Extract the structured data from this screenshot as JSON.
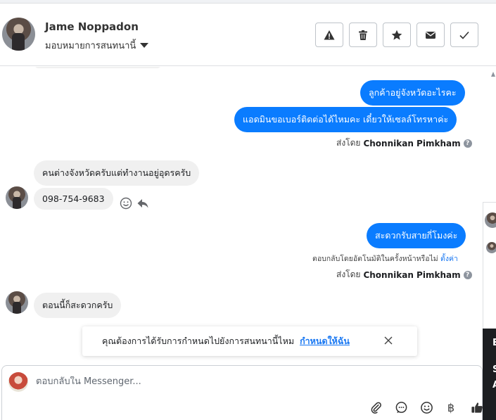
{
  "header": {
    "name": "Jame Noppadon",
    "assign_label": "มอบหมายการสนทนานี้",
    "buttons": {
      "spam": "spam-icon",
      "delete": "trash-icon",
      "star": "star-icon",
      "mark_unread": "envelope-icon",
      "done": "check-icon"
    }
  },
  "messages": {
    "out1": "ลูกค้าอยู่จังหวัดอะไรคะ",
    "out2": "แอดมินขอเบอร์ติดต่อได้ไหมคะ เดี๋ยวให้เซลล์โทรหาค่ะ",
    "sent_by_1_prefix": "ส่งโดย",
    "sent_by_1_name": "Chonnikan Pimkham",
    "in1": "คนต่างจังหวัดครับแต่ทำงานอยู่อุดรครับ",
    "in2": "098-754-9683",
    "out3": "สะดวกรับสายกี่โมงค่ะ",
    "auto_note_text": "ตอบกลับโดยอัตโนมัติในครั้งหน้าหรือไม่",
    "auto_note_link": "ตั้งค่า",
    "sent_by_2_prefix": "ส่งโดย",
    "sent_by_2_name": "Chonnikan Pimkham",
    "in3": "ตอนนี้ก็สะดวกครับ"
  },
  "toast": {
    "text": "คุณต้องการได้รับการกำหนดไปยังการสนทนานี้ไหม",
    "action": "กำหนดให้ฉัน"
  },
  "composer": {
    "placeholder": "ตอบกลับใน Messenger...",
    "tools": [
      "paperclip-icon",
      "saved-reply-icon",
      "emoji-icon",
      "baht-icon",
      "thumbs-up-icon"
    ],
    "baht_symbol": "฿"
  },
  "side_panel": {
    "letters": [
      "E",
      "S",
      "A"
    ]
  },
  "colors": {
    "accent": "#0a7cff",
    "incoming_bubble": "#f0f0f0",
    "link": "#1877f2"
  }
}
